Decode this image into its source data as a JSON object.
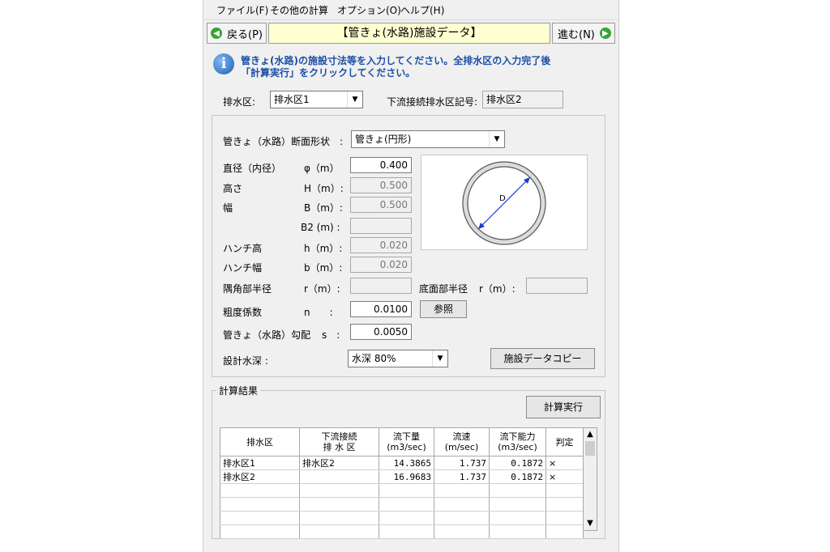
{
  "menu": [
    "ファイル(F)",
    "その他の計算",
    "オプション(O)",
    "ヘルプ(H)"
  ],
  "nav": {
    "back": "戻る(P)",
    "title": "【管きょ(水路)施設データ】",
    "next": "進む(N)"
  },
  "info": {
    "line1": "管きょ(水路)の施設寸法等を入力してください。全排水区の入力完了後",
    "line2": "「計算実行」をクリックしてください。"
  },
  "district": {
    "label": "排水区:",
    "value": "排水区1",
    "downstream_label": "下流接続排水区記号:",
    "downstream_value": "排水区2"
  },
  "shape": {
    "label": "管きょ（水路）断面形状　:",
    "value": "管きょ(円形)"
  },
  "params": {
    "diameter": {
      "name": "直径（内径）",
      "sym": "φ（m）",
      "value": "0.400"
    },
    "height": {
      "name": "高さ",
      "sym": "H（m）:",
      "value": "0.500"
    },
    "width": {
      "name": "幅",
      "sym": "B（m）:",
      "value": "0.500"
    },
    "b2": {
      "name": "",
      "sym": "B2 (m) :",
      "value": ""
    },
    "haunch_h": {
      "name": "ハンチ高",
      "sym": "h（m）:",
      "value": "0.020"
    },
    "haunch_w": {
      "name": "ハンチ幅",
      "sym": "b（m）:",
      "value": "0.020"
    },
    "corner_r": {
      "name": "隅角部半径",
      "sym": "r（m）:",
      "value": ""
    },
    "bottom_r": {
      "name": "底面部半径",
      "sym": "r（m）:",
      "value": ""
    },
    "roughness": {
      "name": "粗度係数",
      "sym": "n　　:",
      "value": "0.0100"
    },
    "slope": {
      "name": "管きょ（水路）勾配",
      "sym": "s　:",
      "value": "0.0050"
    }
  },
  "diagram": {
    "label": "D"
  },
  "ref_button": "参照",
  "depth": {
    "label": "設計水深 :",
    "value": "水深 80%"
  },
  "copy_button": "施設データコピー",
  "results": {
    "legend": "計算結果",
    "run_button": "計算実行",
    "headers": [
      [
        "排水区"
      ],
      [
        "下流接続",
        "排 水 区"
      ],
      [
        "流下量",
        "(m3/sec)"
      ],
      [
        "流速",
        "(m/sec)"
      ],
      [
        "流下能力",
        "(m3/sec)"
      ],
      [
        "判定"
      ]
    ],
    "rows": [
      [
        "排水区1",
        "排水区2",
        "14.3865",
        "1.737",
        "0.1872",
        "×"
      ],
      [
        "排水区2",
        "",
        "16.9683",
        "1.737",
        "0.1872",
        "×"
      ],
      [
        "",
        "",
        "",
        "",
        "",
        ""
      ],
      [
        "",
        "",
        "",
        "",
        "",
        ""
      ],
      [
        "",
        "",
        "",
        "",
        "",
        ""
      ],
      [
        "",
        "",
        "",
        "",
        "",
        ""
      ]
    ]
  }
}
